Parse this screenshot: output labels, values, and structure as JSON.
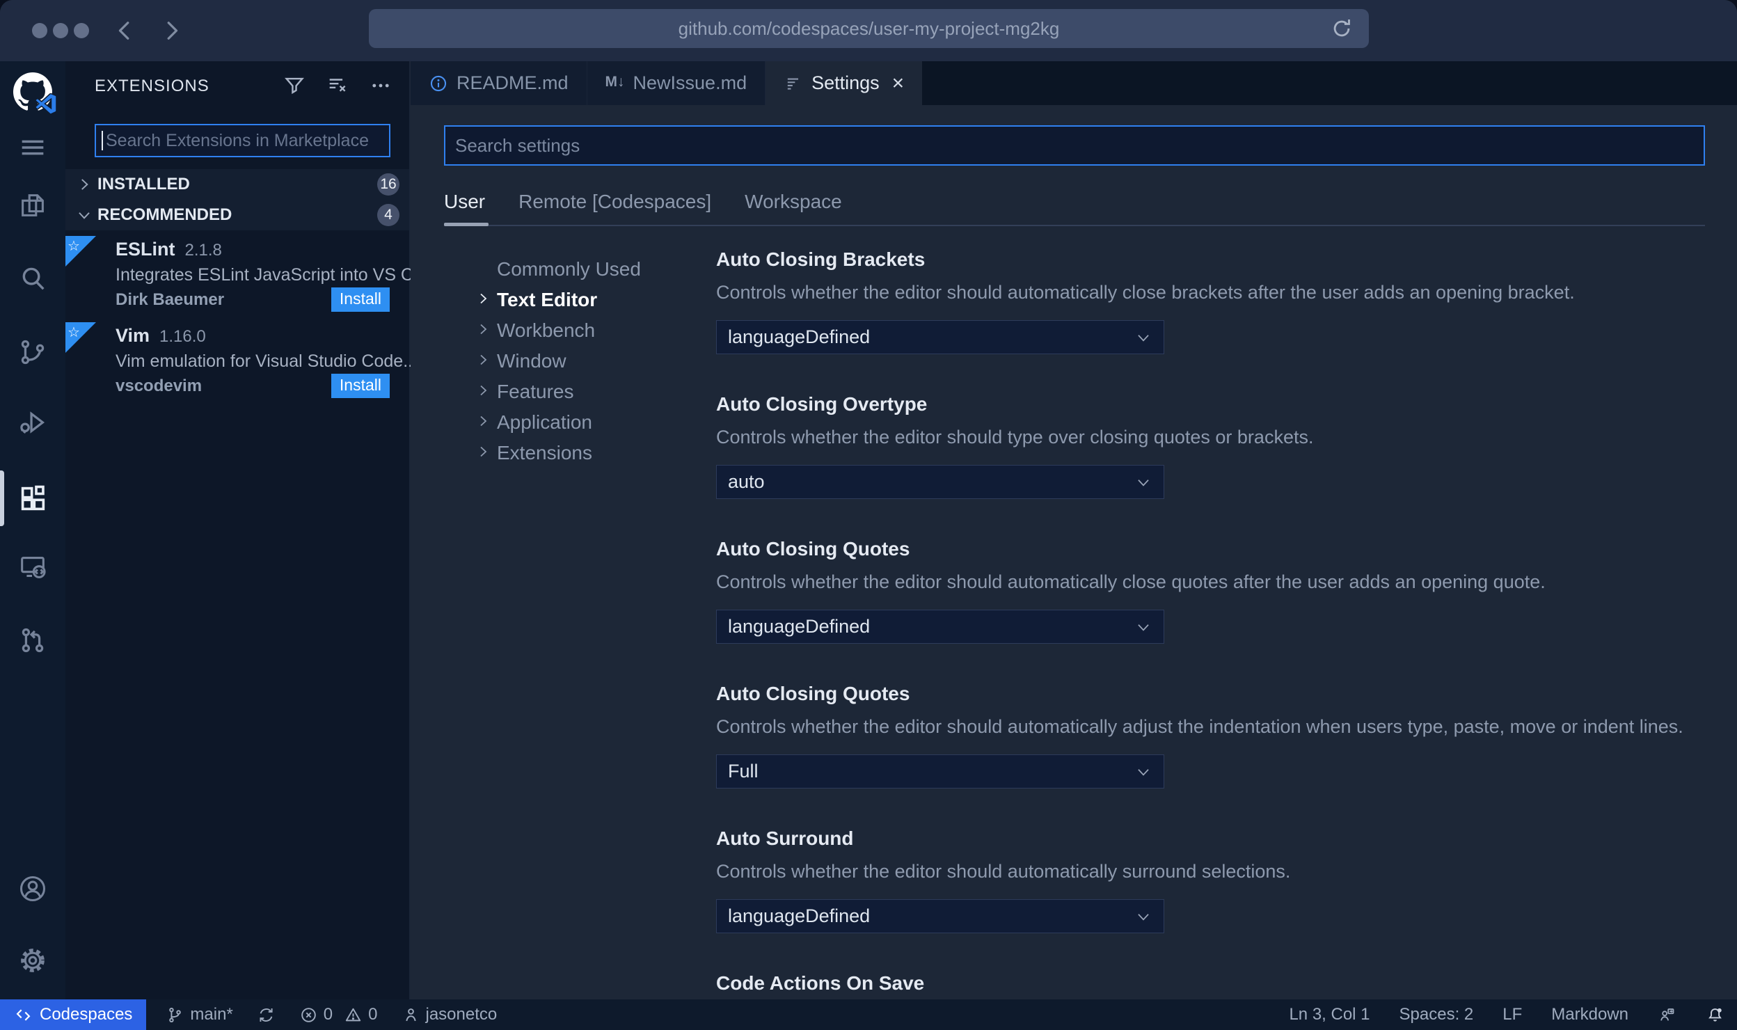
{
  "browser": {
    "url": "github.com/codespaces/user-my-project-mg2kg"
  },
  "sidebar": {
    "title": "EXTENSIONS",
    "search": {
      "placeholder": "Search Extensions in Marketplace"
    },
    "sections": [
      {
        "label": "INSTALLED",
        "count": "16"
      },
      {
        "label": "RECOMMENDED",
        "count": "4"
      }
    ],
    "extensions": [
      {
        "name": "ESLint",
        "version": "2.1.8",
        "description": "Integrates ESLint JavaScript into VS C...",
        "author": "Dirk Baeumer",
        "action": "Install"
      },
      {
        "name": "Vim",
        "version": "1.16.0",
        "description": "Vim emulation for Visual Studio Code...",
        "author": "vscodevim",
        "action": "Install"
      }
    ],
    "ribbon_star": "☆"
  },
  "editor": {
    "tabs": [
      {
        "label": "README.md"
      },
      {
        "label": "NewIssue.md",
        "icon_text": "M↓"
      },
      {
        "label": "Settings",
        "close": "×"
      }
    ]
  },
  "settings": {
    "search": {
      "placeholder": "Search settings"
    },
    "scopes": [
      "User",
      "Remote [Codespaces]",
      "Workspace"
    ],
    "toc": [
      "Commonly Used",
      "Text Editor",
      "Workbench",
      "Window",
      "Features",
      "Application",
      "Extensions"
    ],
    "items": [
      {
        "title": "Auto Closing Brackets",
        "description": "Controls whether the editor should automatically close brackets after the user adds an opening bracket.",
        "value": "languageDefined"
      },
      {
        "title": "Auto Closing Overtype",
        "description": "Controls whether the editor should type over closing quotes or brackets.",
        "value": "auto"
      },
      {
        "title": "Auto Closing Quotes",
        "description": "Controls whether the editor should automatically close quotes after the user adds an opening quote.",
        "value": "languageDefined"
      },
      {
        "title": "Auto Closing Quotes",
        "description": "Controls whether the editor should automatically adjust the indentation when users type, paste, move or indent lines.",
        "value": "Full"
      },
      {
        "title": "Auto Surround",
        "description": "Controls whether the editor should automatically surround selections.",
        "value": "languageDefined"
      },
      {
        "title": "Code Actions On Save"
      }
    ]
  },
  "status_bar": {
    "codespaces": "Codespaces",
    "branch": "main*",
    "errors": "0",
    "warnings": "0",
    "user": "jasonetco",
    "cursor": "Ln 3, Col 1",
    "indent": "Spaces: 2",
    "eol": "LF",
    "language": "Markdown"
  },
  "colors": {
    "focus_border": "#2f80f0",
    "install_blue": "#2e8ff2",
    "codespaces_blue": "#2c62e4",
    "editor_bg": "#1d2737",
    "sidebar_bg": "#0d1728"
  }
}
